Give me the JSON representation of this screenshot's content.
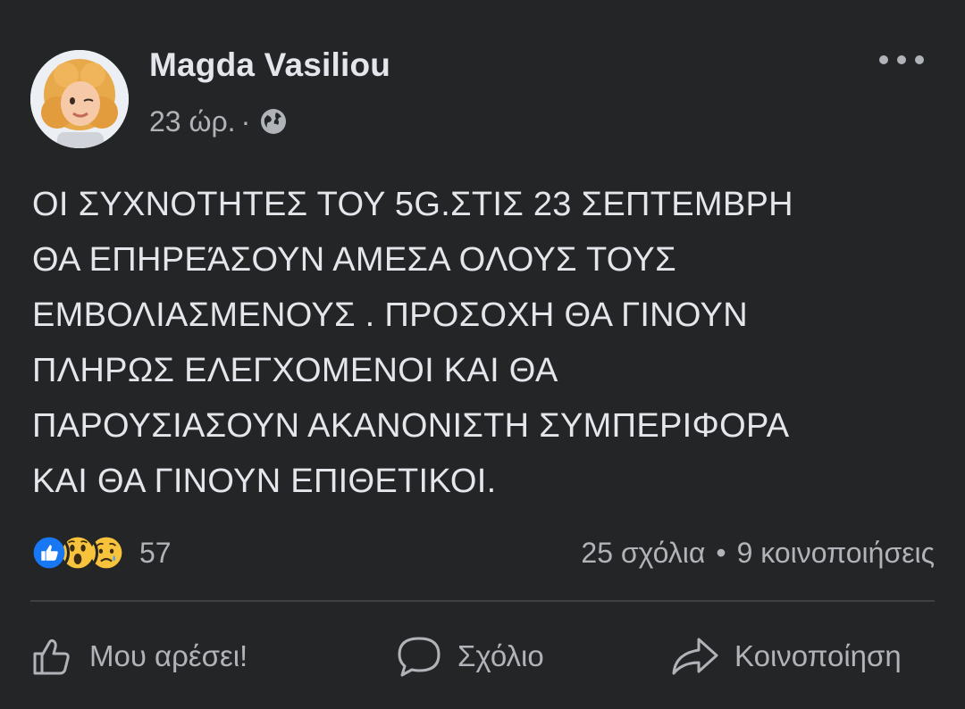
{
  "post": {
    "author": "Magda Vasiliou",
    "time": "23 ώρ.",
    "separator": "·",
    "privacy_icon": "globe-icon",
    "lines": [
      "ΟΙ ΣΥΧΝΟΤΗΤΕΣ ΤΟΥ 5G.ΣΤΙΣ 23 ΣΕΠΤΕΜΒΡΗ",
      "ΘΑ ΕΠΗΡΕΆΣΟΥΝ ΑΜΕΣΑ ΟΛΟΥΣ ΤΟΥΣ",
      "ΕΜΒΟΛΙΑΣΜΕΝΟΥΣ . ΠΡΟΣΟΧΗ ΘΑ ΓΙΝΟΥΝ",
      "ΠΛΗΡΩΣ ΕΛΕΓΧΟΜΕΝΟΙ ΚΑΙ ΘΑ",
      "ΠΑΡΟΥΣΙΑΣΟΥΝ ΑΚΑΝΟΝΙΣΤΗ ΣΥΜΠΕΡΙΦΟΡΑ",
      "ΚΑΙ ΘΑ ΓΙΝΟΥΝ ΕΠΙΘΕΤΙΚΟΙ."
    ]
  },
  "reactions": {
    "icons": [
      "like-icon",
      "wow-icon",
      "sad-icon"
    ],
    "count": "57"
  },
  "stats": {
    "comments": "25 σχόλια",
    "dot": "•",
    "shares": "9 κοινοποιήσεις"
  },
  "actions": {
    "like": "Μου αρέσει!",
    "comment": "Σχόλιο",
    "share": "Κοινοποίηση"
  },
  "colors": {
    "background": "#242526",
    "text": "#e4e6eb",
    "secondary": "#b0b3b8",
    "like_blue": "#1877f2",
    "emoji_yellow": "#f7c33c"
  }
}
